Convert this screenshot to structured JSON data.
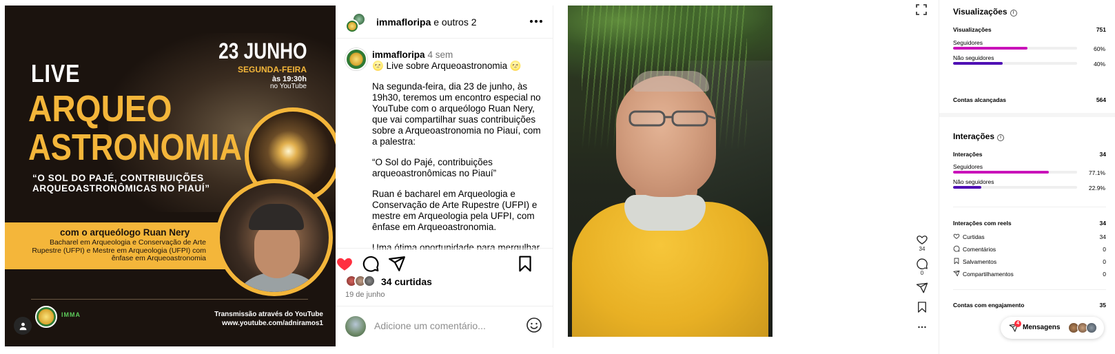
{
  "poster": {
    "live": "LIVE",
    "title_line1": "ARQUEO",
    "title_line2": "ASTRONOMIA",
    "quote": "“O SOL DO PAJÉ, CONTRIBUIÇÕES ARQUEOASTRONÔMICAS NO PIAUÍ”",
    "date": "23 JUNHO",
    "weekday": "SEGUNDA-FEIRA",
    "time": "às 19:30h",
    "where": "no YouTube",
    "band_title": "com o arqueólogo Ruan Nery",
    "band_text": "Bacharel em Arqueologia e Conservação de Arte Rupestre (UFPI) e Mestre em Arqueologia (UFPI) com ênfase em Arqueoastronomia",
    "transmission_line1": "Transmissão através do YouTube",
    "transmission_line2": "www.youtube.com/adniramos1",
    "logo_text": "IMMA"
  },
  "post": {
    "header_user": "immafloripa",
    "header_rest": " e outros 2",
    "caption_user": "immafloripa",
    "caption_ago": "4 sem",
    "caption_lines": [
      "🌝 Live sobre Arqueoastronomia 🌝",
      "Na segunda-feira, dia 23 de junho, às 19h30, teremos um encontro especial no YouTube com o arqueólogo Ruan Nery, que vai compartilhar suas contribuições sobre a Arqueoastronomia no Piauí, com a palestra:",
      "“O Sol do Pajé, contribuições arqueoastronômicas no Piauí”",
      "Ruan é bacharel em Arqueologia e Conservação de Arte Rupestre (UFPI) e mestre em Arqueologia pela UFPI, com ênfase em Arqueoastronomia.",
      "Uma ótima oportunidade para mergulhar nesse campo de pesquisa que une céu, terra e cultura ancestral."
    ],
    "likes": "34 curtidas",
    "date": "19 de junho",
    "comment_placeholder": "Adicione um comentário...",
    "liked": true
  },
  "reel_side": {
    "likes": "34",
    "comments": "0"
  },
  "insights": {
    "views_title": "Visualizações",
    "views_label": "Visualizações",
    "views_value": "751",
    "followers_label": "Seguidores",
    "followers_pct": "60%",
    "followers_fraction": 0.6,
    "nonfollowers_label": "Não seguidores",
    "nonfollowers_pct": "40%",
    "nonfollowers_fraction": 0.4,
    "reach_label": "Contas alcançadas",
    "reach_value": "564",
    "interactions_title": "Interações",
    "interactions_label": "Interações",
    "interactions_value": "34",
    "i_followers_label": "Seguidores",
    "i_followers_pct": "77.1%",
    "i_followers_fraction": 0.771,
    "i_nonfollowers_label": "Não seguidores",
    "i_nonfollowers_pct": "22.9%",
    "i_nonfollowers_fraction": 0.229,
    "reels_interactions_label": "Interações com reels",
    "reels_interactions_value": "34",
    "items": [
      {
        "label": "Curtidas",
        "value": "34",
        "icon": "heart-icon"
      },
      {
        "label": "Comentários",
        "value": "0",
        "icon": "comment-icon"
      },
      {
        "label": "Salvamentos",
        "value": "0",
        "icon": "bookmark-icon"
      },
      {
        "label": "Compartilhamentos",
        "value": "0",
        "icon": "share-icon"
      }
    ],
    "engaged_label": "Contas com engajamento",
    "engaged_value": "35"
  },
  "messages": {
    "label": "Mensagens",
    "badge": "4"
  },
  "colors": {
    "poster_gold": "#f4b63a",
    "poster_bg": "#1b130e",
    "like_red": "#ff3040",
    "followers_bar": "#c913b9",
    "nonfollowers_bar": "#4f0fb4"
  }
}
